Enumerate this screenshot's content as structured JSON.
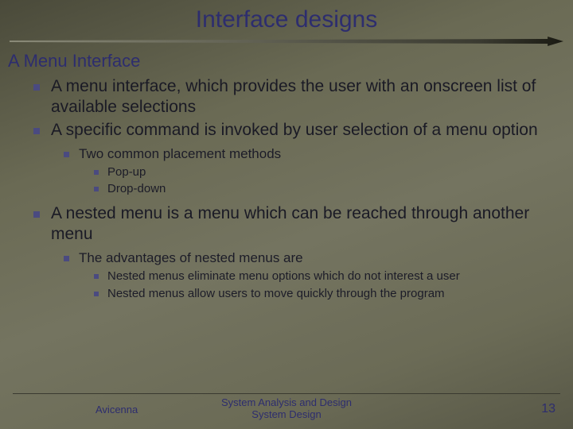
{
  "title": "Interface designs",
  "subtitle": "A Menu Interface",
  "bullets": {
    "b1a": "A menu interface, which provides the user with an onscreen list of available selections",
    "b1b": "A specific command is invoked by user selection of a menu option",
    "b2a": "Two common placement methods",
    "b3a": "Pop-up",
    "b3b": "Drop-down",
    "b1c": "A nested menu is a menu which can be reached through another menu",
    "b2b": "The advantages of nested menus are",
    "b3c": "Nested menus eliminate menu options which do not interest a user",
    "b3d": "Nested menus allow users to move quickly through the program"
  },
  "footer": {
    "left": "Avicenna",
    "center_line1": "System Analysis and Design",
    "center_line2": "System Design",
    "page": "13"
  }
}
